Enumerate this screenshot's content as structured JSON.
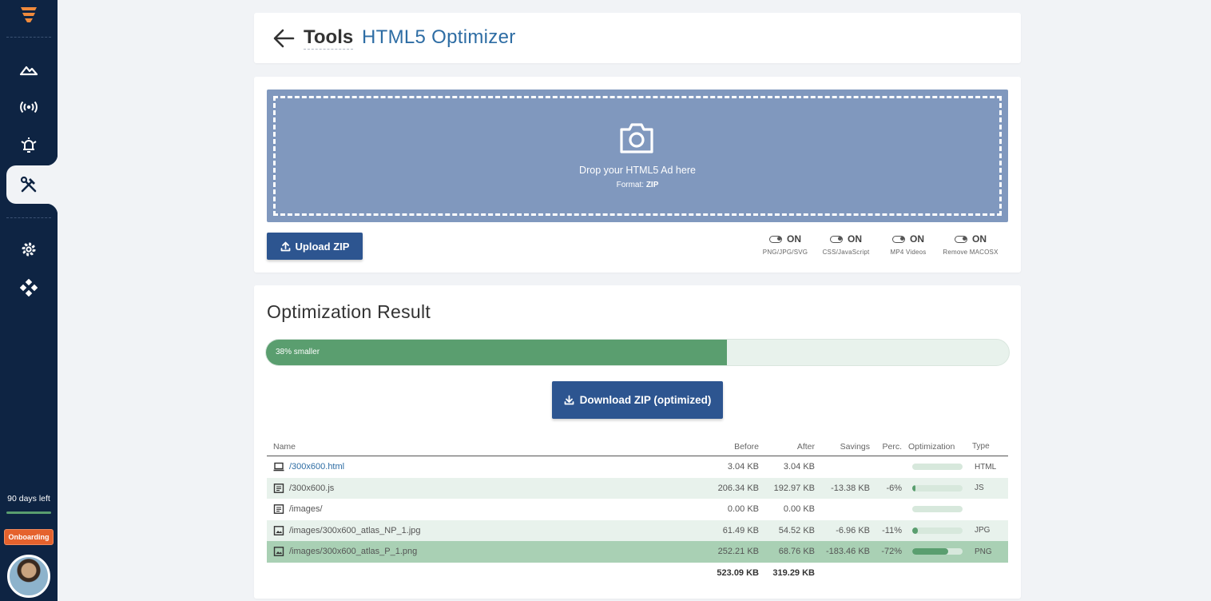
{
  "sidebar": {
    "logo": "brand-logo",
    "days_left": "90 days left",
    "days_progress": 1.0,
    "onboarding_label": "Onboarding",
    "items": [
      {
        "icon": "mountain-icon"
      },
      {
        "icon": "broadcast-icon"
      },
      {
        "icon": "alarm-bell-icon"
      },
      {
        "icon": "tools-icon",
        "active": true
      },
      {
        "icon": "gear-icon"
      },
      {
        "icon": "integrations-icon"
      }
    ]
  },
  "header": {
    "breadcrumb_parent": "Tools",
    "title": "HTML5 Optimizer"
  },
  "upload": {
    "drop_text": "Drop your HTML5 Ad here",
    "format_label": "Format:",
    "format_value": "ZIP",
    "upload_button": "Upload ZIP",
    "toggles": [
      {
        "state": "ON",
        "label": "PNG/JPG/SVG"
      },
      {
        "state": "ON",
        "label": "CSS/JavaScript"
      },
      {
        "state": "ON",
        "label": "MP4 Videos"
      },
      {
        "state": "ON",
        "label": "Remove MACOSX"
      }
    ]
  },
  "result": {
    "title": "Optimization Result",
    "progress_text": "38% smaller",
    "progress_fraction": 0.62,
    "download_button": "Download ZIP (optimized)",
    "columns": {
      "name": "Name",
      "before": "Before",
      "after": "After",
      "savings": "Savings",
      "perc": "Perc.",
      "optimization": "Optimization",
      "type": "Type"
    },
    "rows": [
      {
        "icon": "laptop-icon",
        "name": "/300x600.html",
        "before": "3.04 KB",
        "after": "3.04 KB",
        "savings": "",
        "perc": "",
        "optimization": 0,
        "type": "HTML",
        "link": true,
        "style": ""
      },
      {
        "icon": "document-icon",
        "name": "/300x600.js",
        "before": "206.34 KB",
        "after": "192.97 KB",
        "savings": "-13.38 KB",
        "perc": "-6%",
        "optimization": 0.06,
        "type": "JS",
        "link": false,
        "style": "alt"
      },
      {
        "icon": "document-icon",
        "name": "/images/",
        "before": "0.00 KB",
        "after": "0.00 KB",
        "savings": "",
        "perc": "",
        "optimization": 0,
        "type": "",
        "link": false,
        "style": ""
      },
      {
        "icon": "image-icon",
        "name": "/images/300x600_atlas_NP_1.jpg",
        "before": "61.49 KB",
        "after": "54.52 KB",
        "savings": "-6.96 KB",
        "perc": "-11%",
        "optimization": 0.11,
        "type": "JPG",
        "link": false,
        "style": "alt"
      },
      {
        "icon": "image-icon",
        "name": "/images/300x600_atlas_P_1.png",
        "before": "252.21 KB",
        "after": "68.76 KB",
        "savings": "-183.46 KB",
        "perc": "-72%",
        "optimization": 0.72,
        "type": "PNG",
        "link": false,
        "style": "hl"
      }
    ],
    "total_before": "523.09 KB",
    "total_after": "319.29 KB"
  }
}
